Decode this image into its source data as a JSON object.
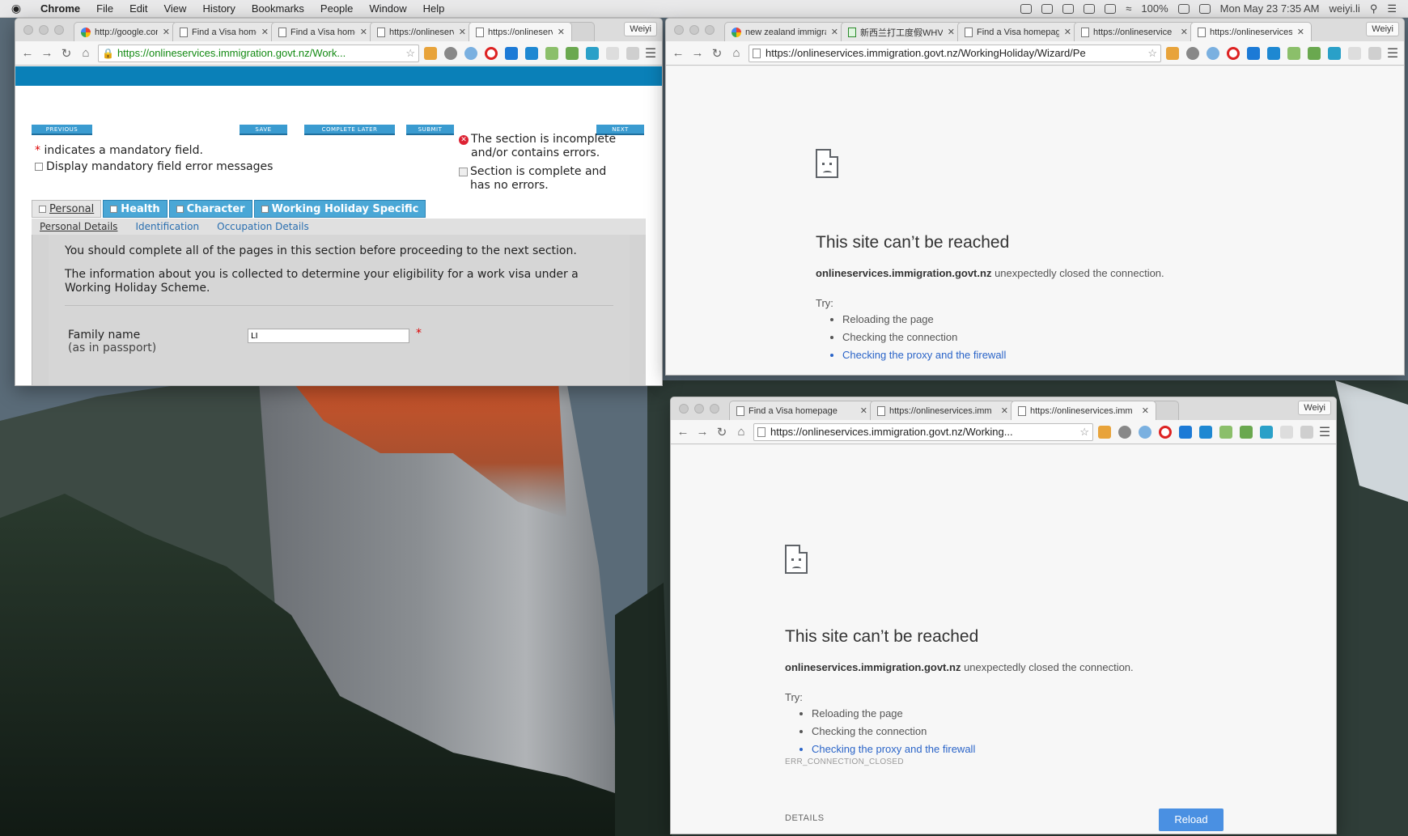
{
  "menubar": {
    "apple": "",
    "items": [
      "Chrome",
      "File",
      "Edit",
      "View",
      "History",
      "Bookmarks",
      "People",
      "Window",
      "Help"
    ],
    "battery": "100%",
    "clock": "Mon May 23  7:35 AM",
    "user": "weiyi.li"
  },
  "win1": {
    "tabs": [
      {
        "title": "http://google.com",
        "favicon": "google-icon"
      },
      {
        "title": "Find a Visa home",
        "favicon": "page-icon"
      },
      {
        "title": "Find a Visa home",
        "favicon": "page-icon"
      },
      {
        "title": "https://onlineserv",
        "favicon": "page-icon"
      },
      {
        "title": "https://onlineserv",
        "favicon": "page-icon"
      }
    ],
    "profile": "Weiyi",
    "url": "https://onlineservices.immigration.govt.nz/Work...",
    "buttons": {
      "previous": "PREVIOUS",
      "save": "SAVE",
      "complete_later": "COMPLETE LATER",
      "submit": "SUBMIT",
      "next": "NEXT"
    },
    "mandatory_note": "indicates a mandatory field.",
    "mandatory_star": "*",
    "display_errors": "Display mandatory field error messages",
    "legend_incomplete": "The section is incomplete and/or contains errors.",
    "legend_complete": "Section is complete and has no errors.",
    "section_tabs": [
      "Personal",
      "Health",
      "Character",
      "Working Holiday Specific"
    ],
    "sub_tabs": [
      "Personal Details",
      "Identification",
      "Occupation Details"
    ],
    "info1": "You should complete all of the pages in this section before proceeding to the next section.",
    "info2": "The information about you is collected to determine your eligibility for a work visa under a Working Holiday Scheme.",
    "family_name_label": "Family name",
    "family_name_sub": "(as in passport)",
    "family_name_value": "LI"
  },
  "win2": {
    "tabs": [
      {
        "title": "new zealand immigra",
        "favicon": "google-icon"
      },
      {
        "title": "新西兰打工度假WHV指",
        "favicon": "page-icon"
      },
      {
        "title": "Find a Visa homepage",
        "favicon": "page-icon"
      },
      {
        "title": "https://onlineservice",
        "favicon": "page-icon"
      },
      {
        "title": "https://onlineservices",
        "favicon": "page-icon"
      }
    ],
    "profile": "Weiyi",
    "url": "https://onlineservices.immigration.govt.nz/WorkingHoliday/Wizard/Pe",
    "heading": "This site can’t be reached",
    "host": "onlineservices.immigration.govt.nz",
    "msg": " unexpectedly closed the connection.",
    "try": "Try:",
    "suggestions": [
      "Reloading the page",
      "Checking the connection",
      "Checking the proxy and the firewall"
    ]
  },
  "win3": {
    "tabs": [
      {
        "title": "Find a Visa homepage",
        "favicon": "page-icon"
      },
      {
        "title": "https://onlineservices.imm",
        "favicon": "page-icon"
      },
      {
        "title": "https://onlineservices.imm",
        "favicon": "page-icon"
      }
    ],
    "profile": "Weiyi",
    "url": "https://onlineservices.immigration.govt.nz/Working...",
    "heading": "This site can’t be reached",
    "host": "onlineservices.immigration.govt.nz",
    "msg": " unexpectedly closed the connection.",
    "try": "Try:",
    "suggestions": [
      "Reloading the page",
      "Checking the connection",
      "Checking the proxy and the firewall"
    ],
    "error_code": "ERR_CONNECTION_CLOSED",
    "details": "DETAILS",
    "reload": "Reload"
  }
}
